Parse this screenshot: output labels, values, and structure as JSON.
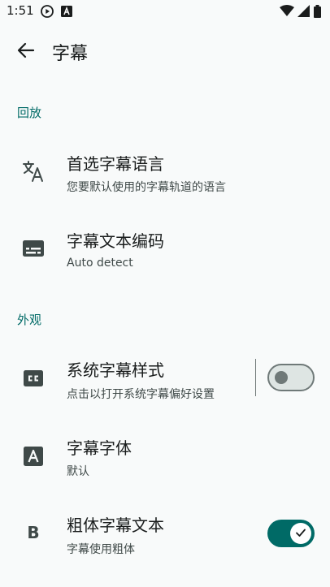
{
  "status_bar": {
    "time": "1:51"
  },
  "header": {
    "title": "字幕"
  },
  "sections": {
    "playback": {
      "label": "回放",
      "preferred_language": {
        "title": "首选字幕语言",
        "summary": "您要默认使用的字幕轨道的语言"
      },
      "text_encoding": {
        "title": "字幕文本编码",
        "summary": "Auto detect"
      }
    },
    "appearance": {
      "label": "外观",
      "system_style": {
        "title": "系统字幕样式",
        "summary": "点击以打开系统字幕偏好设置",
        "enabled": false
      },
      "font": {
        "title": "字幕字体",
        "summary": "默认",
        "icon_letter": "A"
      },
      "bold": {
        "title": "粗体字幕文本",
        "summary": "字幕使用粗体",
        "enabled": true,
        "icon_letter": "B"
      }
    }
  },
  "colors": {
    "accent": "#006a66",
    "background": "#f8fafa",
    "icon": "#3f4948"
  },
  "icons": {
    "status": [
      "play-circle-icon",
      "a-box-icon",
      "wifi-icon",
      "signal-icon",
      "battery-icon"
    ],
    "back": "arrow-back-icon",
    "preferred_language": "translate-icon",
    "text_encoding": "subtitles-icon",
    "system_style": "closed-caption-icon",
    "font": "font-a-icon",
    "bold": "bold-b-icon"
  }
}
